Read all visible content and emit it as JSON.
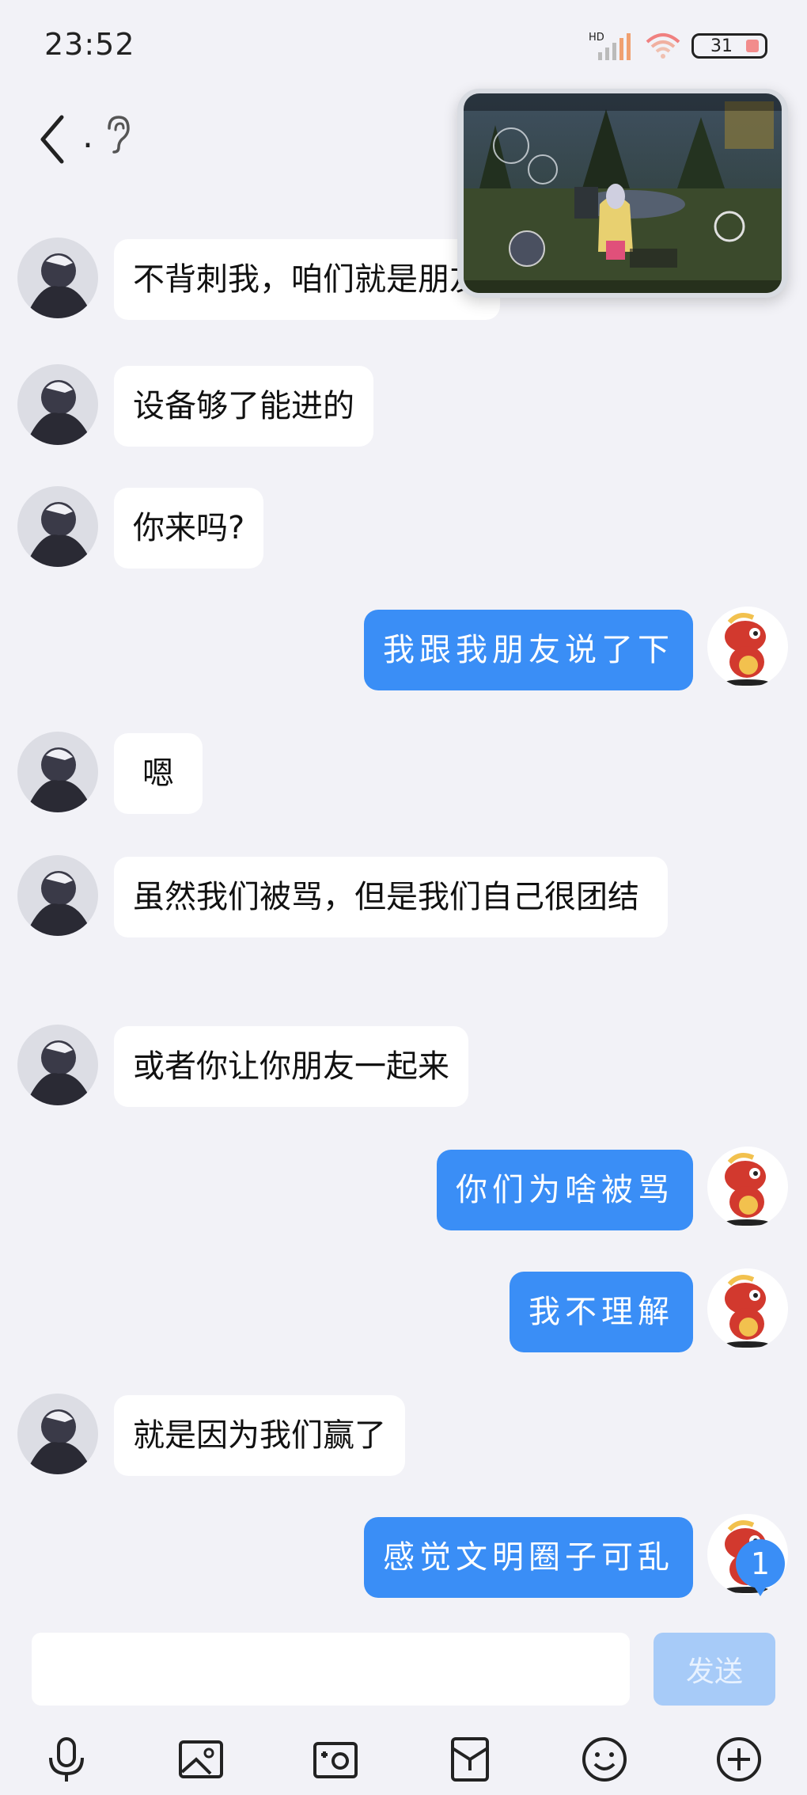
{
  "status_bar": {
    "time": "23:52",
    "battery": "31",
    "network": "HD"
  },
  "header": {
    "title": "."
  },
  "messages": [
    {
      "side": "in",
      "text": "不背刺我，咱们就是朋友"
    },
    {
      "side": "in",
      "text": "设备够了能进的"
    },
    {
      "side": "in",
      "text": "你来吗?"
    },
    {
      "side": "out",
      "text": "我跟我朋友说了下"
    },
    {
      "side": "in",
      "text": "嗯"
    },
    {
      "side": "in",
      "text": "虽然我们被骂，但是我们自己很团结"
    },
    {
      "side": "in",
      "text": "或者你让你朋友一起来"
    },
    {
      "side": "out",
      "text": "你们为啥被骂"
    },
    {
      "side": "out",
      "text": "我不理解"
    },
    {
      "side": "in",
      "text": "就是因为我们赢了"
    },
    {
      "side": "out",
      "text": "感觉文明圈子可乱"
    }
  ],
  "unread_badge": "1",
  "composer": {
    "send_label": "发送"
  },
  "toolbar": {
    "icons": [
      "microphone-icon",
      "image-icon",
      "camera-icon",
      "red-packet-icon",
      "emoji-icon",
      "plus-icon"
    ]
  }
}
